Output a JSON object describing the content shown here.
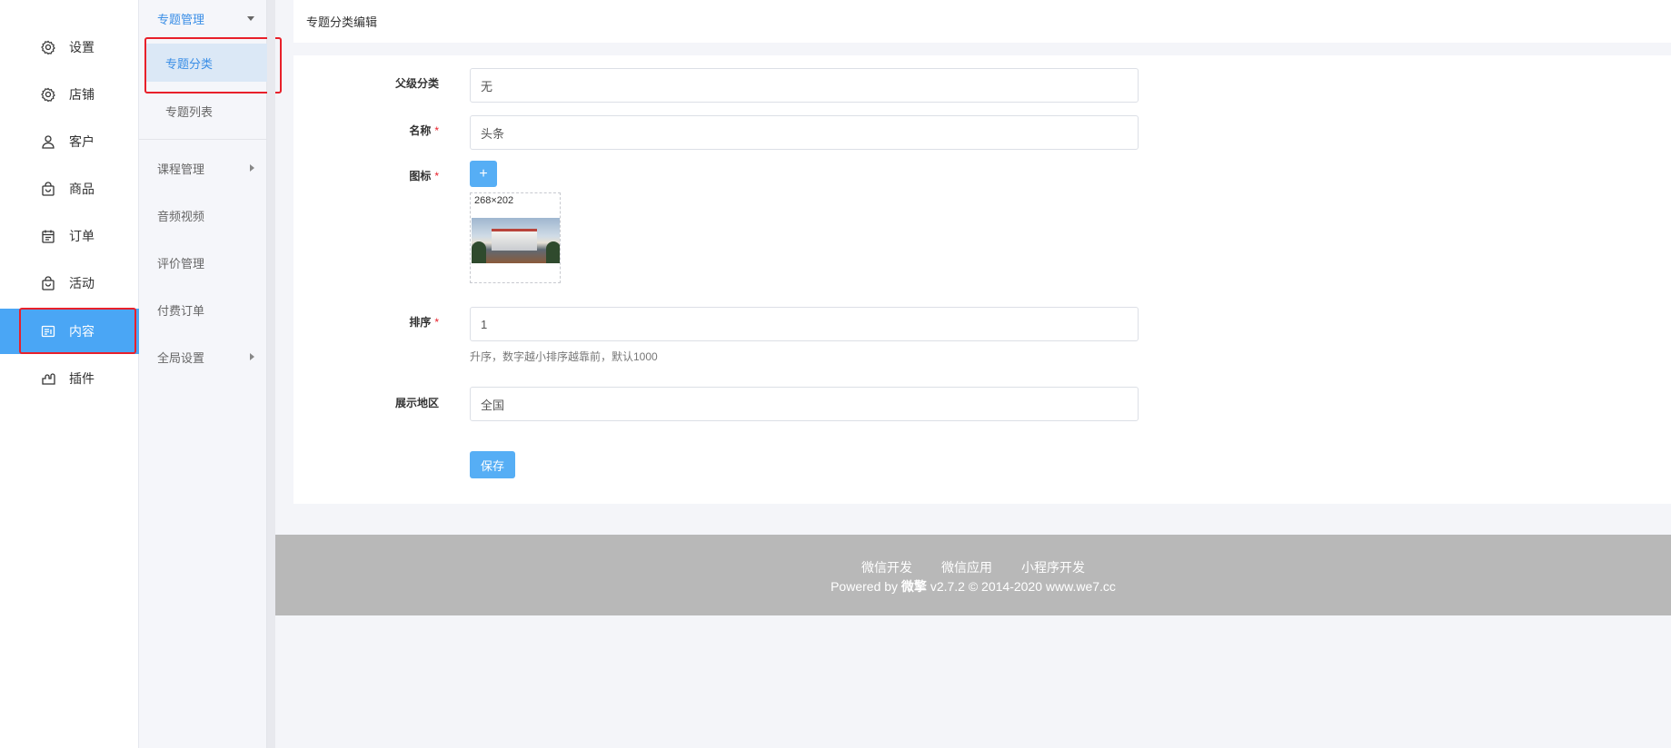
{
  "nav1": {
    "items": [
      {
        "label": "设置",
        "icon": "gear-icon"
      },
      {
        "label": "店铺",
        "icon": "gear-icon"
      },
      {
        "label": "客户",
        "icon": "user-icon"
      },
      {
        "label": "商品",
        "icon": "shopping-bag-icon"
      },
      {
        "label": "订单",
        "icon": "calendar-icon"
      },
      {
        "label": "活动",
        "icon": "shopping-bag-icon"
      },
      {
        "label": "内容",
        "icon": "content-icon"
      },
      {
        "label": "插件",
        "icon": "plugin-icon"
      }
    ],
    "active_index": 6
  },
  "nav2": {
    "group_topic": "专题管理",
    "sub_items": [
      "专题分类",
      "专题列表"
    ],
    "group_course": "课程管理",
    "item_media": "音频视频",
    "item_review": "评价管理",
    "item_paid_order": "付费订单",
    "group_global": "全局设置"
  },
  "header": {
    "title": "专题分类编辑"
  },
  "form": {
    "parent_label": "父级分类",
    "parent_value": "无",
    "name_label": "名称",
    "name_value": "头条",
    "icon_label": "图标",
    "upload_button": "+",
    "image_size": "268×202",
    "sort_label": "排序",
    "sort_value": "1",
    "sort_hint": "升序，数字越小排序越靠前，默认1000",
    "region_label": "展示地区",
    "region_value": "全国",
    "required_mark": "*",
    "save_button": "保存"
  },
  "footer": {
    "links": [
      "微信开发",
      "微信应用",
      "小程序开发"
    ],
    "powered_prefix": "Powered by",
    "brand": "微擎",
    "powered_suffix": "v2.7.2 © 2014-2020 www.we7.cc"
  },
  "colors": {
    "accent": "#4aa6f5",
    "highlight_border": "#e8202a",
    "footer_bg": "#b8b8b8"
  }
}
